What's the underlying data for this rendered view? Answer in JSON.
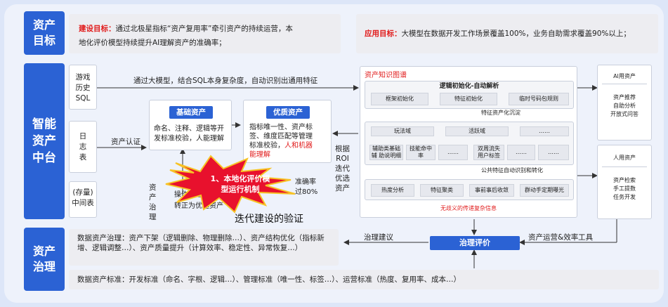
{
  "bands": {
    "goal": "资产\n目标",
    "platform": "智能\n资产\n中台",
    "governance": "资产\n治理"
  },
  "goal": {
    "build_label": "建设目标：",
    "build_line1": "通过北极星指标“资产复用率”牵引资产的持续运营，本",
    "build_line2": "地化评价模型持续提升AI理解资产的准确率；",
    "apply_label": "应用目标：",
    "apply_text": "大模型在数据开发工作场景覆盖100%，业务自助需求覆盖90%以上；"
  },
  "sources": [
    "游戏\n历史\nSQL",
    "日\n志\n表",
    "(存量)\n中间表"
  ],
  "flow": {
    "top_arrow": "通过大模型，结合SQL本身复杂度，自动识别出通用特征",
    "asset_cert": "资产认证",
    "asset_gov": "资\n产\n治\n理",
    "by_roi": "根据\nROI\n迭代\n优选\n资产"
  },
  "basic": {
    "title": "基础资产",
    "text": "命名、注释、逻辑等开\n发标准校验，人能理解"
  },
  "quality": {
    "title": "优质资产",
    "text": "指标唯一性、资产标\n签、维度匹配等管理\n标准校验，",
    "red_text": "人和机器\n能理解"
  },
  "hidden": {
    "line1_tail": "准确率",
    "line2_tail": "过80%",
    "line3": "操作未通过",
    "line4": "转正为优选资产"
  },
  "kg": {
    "title": "资产知识图谱",
    "logic_title": "逻辑初始化-自动解析",
    "logic_chips": [
      "框架初始化",
      "特征初始化",
      "临时号码包规则"
    ],
    "feature_sink": "特征资产化沉淀",
    "domains": [
      "玩法域",
      "活跃域",
      "……"
    ],
    "sub_chips": [
      "辅助类基础辅\n助说明细",
      "技能命中\n率",
      "……",
      "双周流失\n用户标签",
      "……",
      "……"
    ],
    "public_feature": "公共特征自动识别和转化",
    "bottom_chips": [
      "热度分析",
      "特征聚类",
      "事前事后收敛",
      "群动手定期曝光"
    ],
    "footer": "无歧义的传递复杂信息"
  },
  "ai_asset": {
    "title": "AI用资产",
    "text": "资产推荐\n自助分析\n开放式问答"
  },
  "human_asset": {
    "title": "人用资产",
    "text": "资产检索\n手工提数\n任务开发"
  },
  "burst": {
    "text": "1、本地化评价模\n型运行机制"
  },
  "verify": "迭代建设的验证",
  "gov": {
    "text": "数据资产治理：资产下架（逻辑删除、物理删除…）、资产结构优化（指标新增、逻辑调整…）、资产质量提升（计算效率、稳定性、异常恢复…）",
    "advice": "治理建议",
    "eval": "治理评价",
    "ops": "资产运营&效率工具",
    "standard": "数据资产标准：开发标准（命名、字根、逻辑…）、管理标准（唯一性、标签…）、运营标准（热度、复用率、成本…）"
  }
}
